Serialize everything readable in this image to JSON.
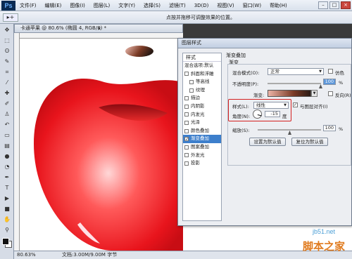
{
  "app": {
    "logo": "Ps"
  },
  "menu": {
    "items": [
      "文件(F)",
      "编辑(E)",
      "图像(I)",
      "图层(L)",
      "文字(Y)",
      "选择(S)",
      "滤镜(T)",
      "3D(D)",
      "视图(V)",
      "窗口(W)",
      "帮助(H)"
    ]
  },
  "window_controls": {
    "minimize": "–",
    "maximize": "□",
    "close": "×"
  },
  "options": {
    "tool_glyph": "▸+",
    "hint": "点按并拖移可调整效果的位置。"
  },
  "document": {
    "tab_label": "卡通苹果 @ 80.6% (椭圆 4, RGB/8) *",
    "tab_close": "×",
    "status_zoom": "80.63%",
    "status_doc": "文档:3.00M/9.00M 字节"
  },
  "dialog": {
    "title": "图层样式",
    "styles_header": "样式",
    "blend_options": "混合选项:默认",
    "styles": [
      {
        "label": "斜面和浮雕",
        "checked": false,
        "sub": false,
        "active": false
      },
      {
        "label": "等高线",
        "checked": false,
        "sub": true,
        "active": false
      },
      {
        "label": "纹理",
        "checked": false,
        "sub": true,
        "active": false
      },
      {
        "label": "描边",
        "checked": false,
        "sub": false,
        "active": false
      },
      {
        "label": "内阴影",
        "checked": false,
        "sub": false,
        "active": false
      },
      {
        "label": "内发光",
        "checked": false,
        "sub": false,
        "active": false
      },
      {
        "label": "光泽",
        "checked": false,
        "sub": false,
        "active": false
      },
      {
        "label": "颜色叠加",
        "checked": false,
        "sub": false,
        "active": false
      },
      {
        "label": "渐变叠加",
        "checked": true,
        "sub": false,
        "active": true
      },
      {
        "label": "图案叠加",
        "checked": false,
        "sub": false,
        "active": false
      },
      {
        "label": "外发光",
        "checked": false,
        "sub": false,
        "active": false
      },
      {
        "label": "投影",
        "checked": false,
        "sub": false,
        "active": false
      }
    ],
    "group_title": "渐变叠加",
    "group_sub": "渐变",
    "blend_mode_label": "混合模式(O):",
    "blend_mode_value": "正常",
    "dither_label": "仿色",
    "opacity_label": "不透明度(P):",
    "opacity_value": "100",
    "opacity_unit": "%",
    "gradient_label": "渐变:",
    "reverse_label": "反向(R)",
    "style_label": "样式(L):",
    "style_value": "线性",
    "align_label": "与图层对齐(I)",
    "angle_label": "角度(N):",
    "angle_value": "-15",
    "angle_unit": "度",
    "scale_label": "缩放(S):",
    "scale_value": "100",
    "scale_unit": "%",
    "btn_default": "设置为默认值",
    "btn_reset": "复位为默认值"
  },
  "watermark": {
    "site": "jb51.net",
    "brand": "脚本之家"
  },
  "colors": {
    "apple_red": "#e8141c",
    "highlight_blue": "#3d7fcc",
    "annotation_red": "#d42020"
  }
}
